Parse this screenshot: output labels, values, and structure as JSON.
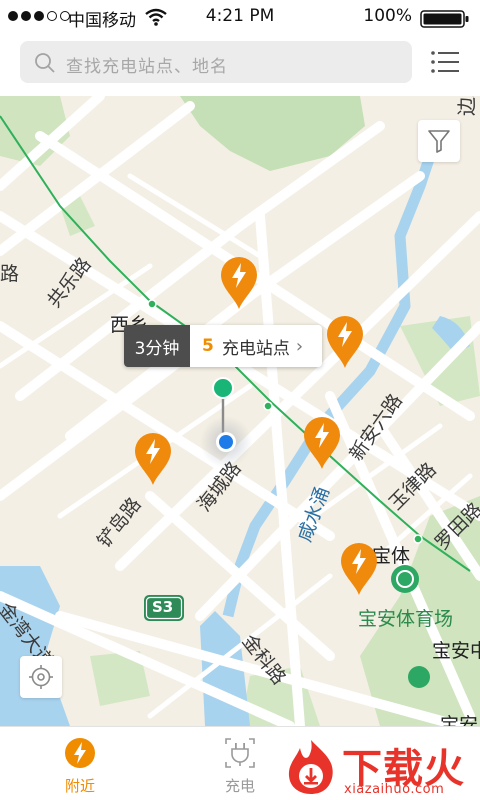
{
  "status_bar": {
    "carrier": "中国移动",
    "time": "4:21 PM",
    "battery": "100%"
  },
  "search": {
    "placeholder": "查找充电站点、地名"
  },
  "icons": {
    "search": "search-icon",
    "menu": "list-icon",
    "filter": "filter-icon",
    "locate": "locate-icon",
    "station_pin": "lightning-pin-icon",
    "tab_nearby": "lightning-icon",
    "tab_charge": "plug-icon"
  },
  "colors": {
    "accent": "#f08c00",
    "pin": "#f08a0d",
    "metro_line": "#2fb05a",
    "river": "#a8d3ef",
    "user_dot": "#1e7ce8",
    "start_pin": "#19b576"
  },
  "route_bubble": {
    "duration": "3分钟",
    "station_count": "5",
    "station_label": "充电站点",
    "chevron": "›"
  },
  "map_labels": {
    "gongle_road": "共乐路",
    "xixiang": "西乡",
    "haicheng_road": "海城路",
    "chandao_road": "铲岛路",
    "xianshui_chong": "咸水涌",
    "xinan_6_road": "新安六路",
    "yulv_road": "玉律路",
    "luotian_road": "罗田路",
    "baoti": "宝体",
    "baoan_stadium": "宝安体育场",
    "jinwan_avenue": "金湾大道",
    "jinke_road": "金科路",
    "baoan_center": "宝安中",
    "baoan_partial": "宝安",
    "s3": "S3",
    "edge_road_left": "路",
    "edge_road_top_right": "边路",
    "edge_road_right": "玉律",
    "edge_road_right2": "径"
  },
  "tabs": {
    "nearby": "附近",
    "charge": "充电"
  },
  "watermark": {
    "word": "下载火",
    "site": "xiazaihuo.com"
  }
}
